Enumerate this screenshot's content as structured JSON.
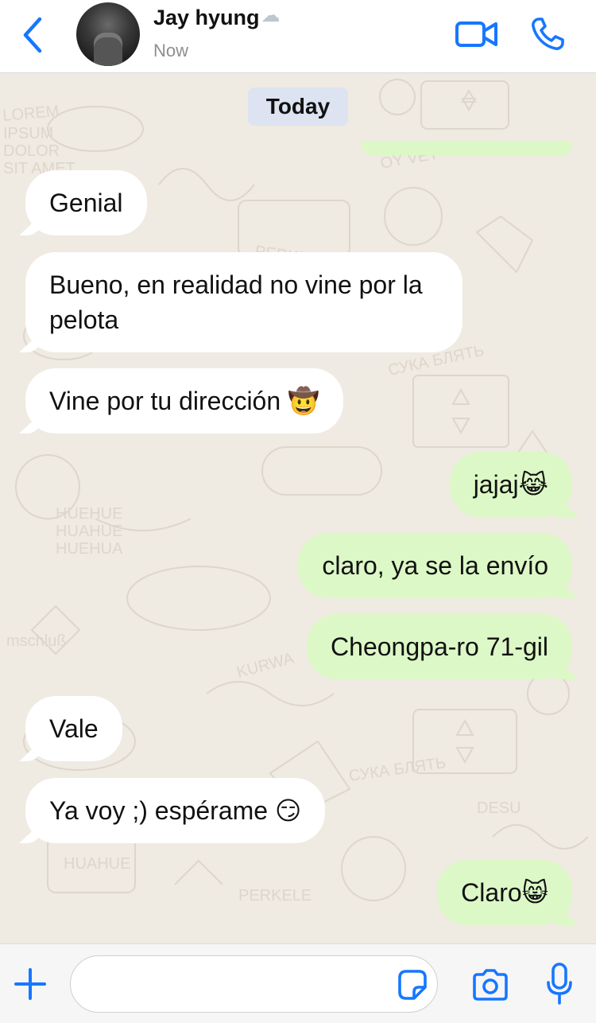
{
  "header": {
    "contact_name": "Jay hyung",
    "status": "Now"
  },
  "chat": {
    "date_label": "Today",
    "messages": [
      {
        "direction": "incoming",
        "text": "Genial"
      },
      {
        "direction": "incoming",
        "text": "Bueno, en realidad no vine por la pelota"
      },
      {
        "direction": "incoming",
        "text": "Vine por tu dirección",
        "emoji": "🤠"
      },
      {
        "direction": "outgoing",
        "text": "jajaj",
        "emoji": "😹"
      },
      {
        "direction": "outgoing",
        "text": "claro, ya se la envío"
      },
      {
        "direction": "outgoing",
        "text": "Cheongpa-ro 71-gil"
      },
      {
        "direction": "incoming",
        "text": "Vale"
      },
      {
        "direction": "incoming",
        "text": "Ya voy ;) espérame",
        "emoji": "😏"
      },
      {
        "direction": "outgoing",
        "text": "Claro",
        "emoji": "😸"
      }
    ]
  },
  "composer": {
    "value": "",
    "placeholder": ""
  },
  "icons": {
    "back": "chevron-left-icon",
    "video": "video-camera-icon",
    "call": "phone-icon",
    "plus": "plus-icon",
    "sticker": "sticker-icon",
    "camera": "camera-icon",
    "mic": "microphone-icon",
    "status_emoji": "cloud-icon"
  },
  "colors": {
    "accent": "#1677ff",
    "incoming_bubble": "#ffffff",
    "outgoing_bubble": "#dcf8c6",
    "chat_background": "#efeae2",
    "date_pill": "#dde3f1"
  }
}
